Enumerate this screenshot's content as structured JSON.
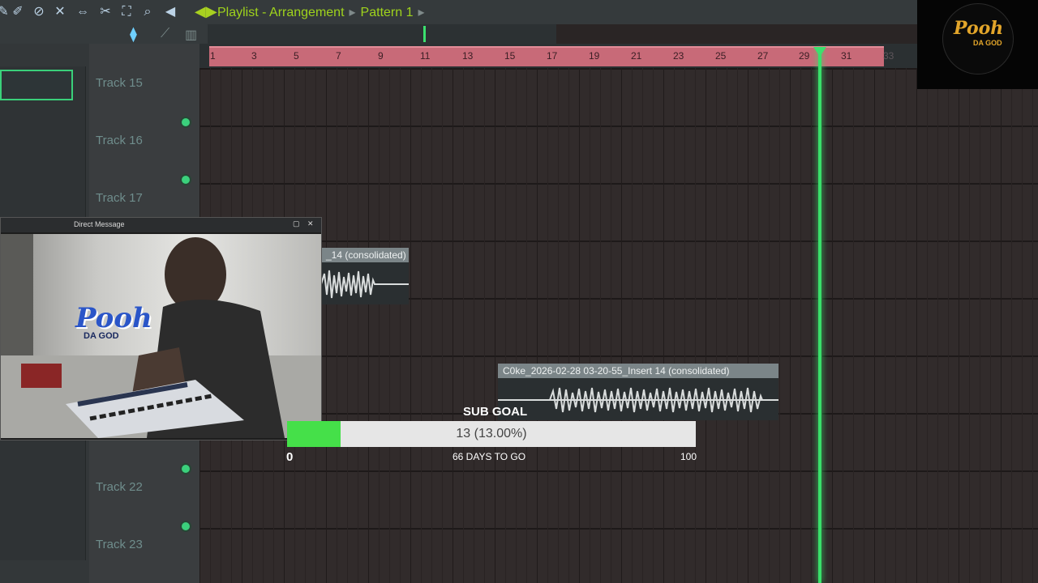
{
  "header": {
    "title": "Playlist - Arrangement",
    "pattern": "Pattern 1"
  },
  "tracks": [
    {
      "label": "Track 15"
    },
    {
      "label": "Track 16"
    },
    {
      "label": "Track 17"
    },
    {
      "label": "Track 22"
    },
    {
      "label": "Track 23"
    }
  ],
  "ruler": {
    "ticks": [
      "1",
      "3",
      "5",
      "7",
      "9",
      "11",
      "13",
      "15",
      "17",
      "19",
      "21",
      "23",
      "25",
      "27",
      "29",
      "31",
      "33"
    ]
  },
  "clips": [
    {
      "title": "_14 (consolidated)"
    },
    {
      "title": "C0ke_2026-02-28 03-20-55_Insert 14 (consolidated)"
    }
  ],
  "webcam": {
    "window_title": "Direct Message",
    "overlay_logo_text": "Pooh",
    "overlay_logo_sub": "DA GOD"
  },
  "logo": {
    "text": "Pooh",
    "sub": "DA GOD"
  },
  "sub_goal": {
    "label": "SUB GOAL",
    "value_text": "13 (13.00%)",
    "progress_fraction": 0.13,
    "min": "0",
    "max": "100",
    "days_text": "66 DAYS TO GO"
  },
  "colors": {
    "accent_green": "#3be06e",
    "ruler_pink": "#c86a78",
    "title_green": "#9fd31c"
  }
}
